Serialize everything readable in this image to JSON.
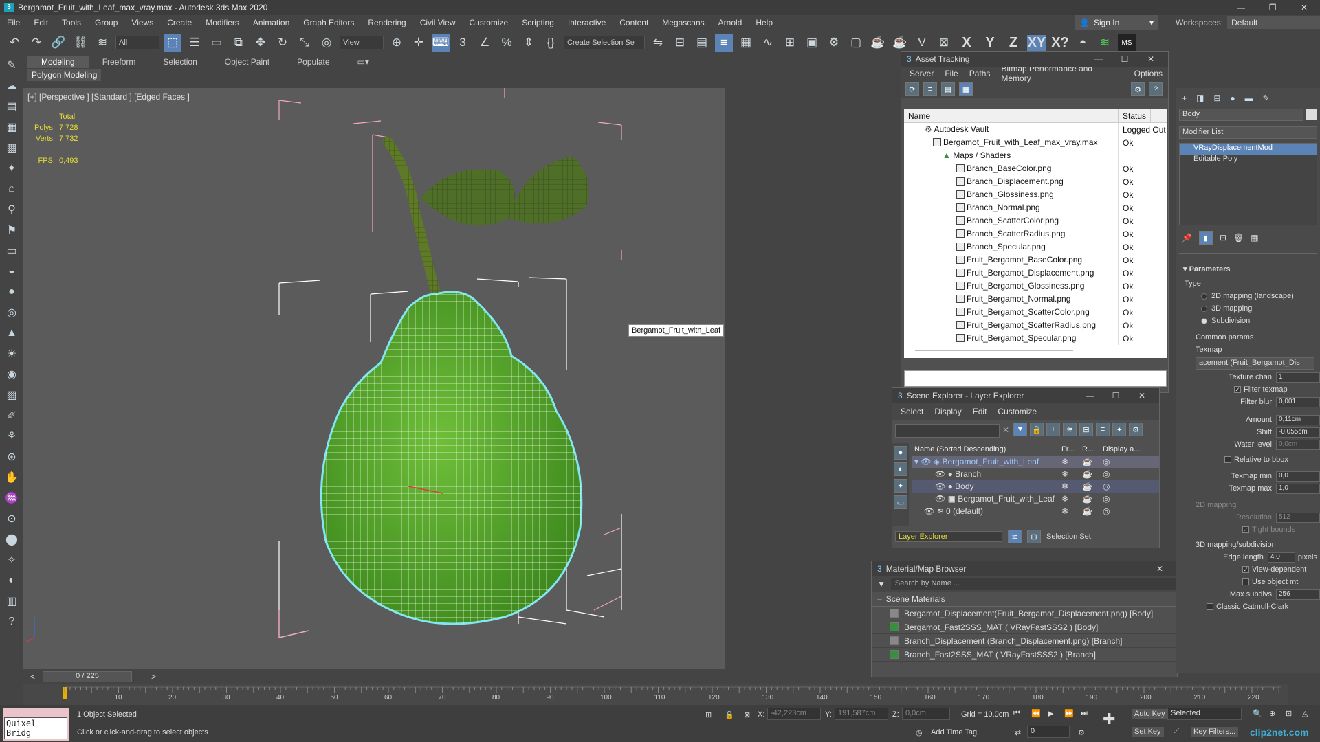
{
  "window": {
    "title": "Bergamot_Fruit_with_Leaf_max_vray.max - Autodesk 3ds Max 2020",
    "app_icon": "3"
  },
  "menu": [
    "File",
    "Edit",
    "Tools",
    "Group",
    "Views",
    "Create",
    "Modifiers",
    "Animation",
    "Graph Editors",
    "Rendering",
    "Civil View",
    "Customize",
    "Scripting",
    "Interactive",
    "Content",
    "Megascans",
    "Arnold",
    "Help"
  ],
  "signin": {
    "label": "Sign In"
  },
  "workspaces": {
    "label": "Workspaces:",
    "value": "Default"
  },
  "toolbar": {
    "filter": "All",
    "refcoord": "View",
    "selset": "Create Selection Se",
    "axes": [
      "X",
      "Y",
      "Z",
      "XY",
      "X?"
    ]
  },
  "ribbon": {
    "tabs": [
      "Modeling",
      "Freeform",
      "Selection",
      "Object Paint",
      "Populate"
    ],
    "sub": "Polygon Modeling"
  },
  "viewport": {
    "label": "[+] [Perspective ] [Standard ] [Edged Faces ]",
    "stats": {
      "total": "Total",
      "polys_label": "Polys:",
      "polys": "7 728",
      "verts_label": "Verts:",
      "verts": "7 732",
      "fps_label": "FPS:",
      "fps": "0,493"
    },
    "tooltip": "Bergamot_Fruit_with_Leaf"
  },
  "asset_tracking": {
    "title": "Asset Tracking",
    "menu": [
      "Server",
      "File",
      "Paths",
      "Bitmap Performance and Memory",
      "Options"
    ],
    "columns": [
      "Name",
      "Status"
    ],
    "rows": [
      {
        "name": "Autodesk Vault",
        "status": "Logged Out"
      },
      {
        "name": "Bergamot_Fruit_with_Leaf_max_vray.max",
        "status": "Ok"
      },
      {
        "name": "Maps / Shaders",
        "status": ""
      },
      {
        "name": "Branch_BaseColor.png",
        "status": "Ok"
      },
      {
        "name": "Branch_Displacement.png",
        "status": "Ok"
      },
      {
        "name": "Branch_Glossiness.png",
        "status": "Ok"
      },
      {
        "name": "Branch_Normal.png",
        "status": "Ok"
      },
      {
        "name": "Branch_ScatterColor.png",
        "status": "Ok"
      },
      {
        "name": "Branch_ScatterRadius.png",
        "status": "Ok"
      },
      {
        "name": "Branch_Specular.png",
        "status": "Ok"
      },
      {
        "name": "Fruit_Bergamot_BaseColor.png",
        "status": "Ok"
      },
      {
        "name": "Fruit_Bergamot_Displacement.png",
        "status": "Ok"
      },
      {
        "name": "Fruit_Bergamot_Glossiness.png",
        "status": "Ok"
      },
      {
        "name": "Fruit_Bergamot_Normal.png",
        "status": "Ok"
      },
      {
        "name": "Fruit_Bergamot_ScatterColor.png",
        "status": "Ok"
      },
      {
        "name": "Fruit_Bergamot_ScatterRadius.png",
        "status": "Ok"
      },
      {
        "name": "Fruit_Bergamot_Specular.png",
        "status": "Ok"
      }
    ]
  },
  "scene_explorer": {
    "title": "Scene Explorer - Layer Explorer",
    "menu": [
      "Select",
      "Display",
      "Edit",
      "Customize"
    ],
    "columns": [
      "Name (Sorted Descending)",
      "Fr...",
      "R...",
      "Display a..."
    ],
    "rows": [
      {
        "name": "Bergamot_Fruit_with_Leaf"
      },
      {
        "name": "Branch"
      },
      {
        "name": "Body"
      },
      {
        "name": "Bergamot_Fruit_with_Leaf"
      },
      {
        "name": "0 (default)"
      }
    ],
    "footer_layer": "Layer Explorer",
    "footer_selset": "Selection Set:"
  },
  "material_browser": {
    "title": "Material/Map Browser",
    "search_placeholder": "Search by Name ...",
    "section": "Scene Materials",
    "items": [
      "Bergamot_Displacement(Fruit_Bergamot_Displacement.png) [Body]",
      "Bergamot_Fast2SSS_MAT ( VRayFastSSS2 ) [Body]",
      "Branch_Displacement (Branch_Displacement.png) [Branch]",
      "Branch_Fast2SSS_MAT ( VRayFastSSS2 ) [Branch]"
    ]
  },
  "command_panel": {
    "object_name": "Body",
    "modifier_list": "Modifier List",
    "modifiers": [
      "VRayDisplacementMod",
      "Editable Poly"
    ],
    "parameters": {
      "title": "Parameters",
      "type_label": "Type",
      "types": [
        "2D mapping (landscape)",
        "3D mapping",
        "Subdivision"
      ],
      "common": "Common params",
      "texmap_label": "Texmap",
      "texmap_value": "acement (Fruit_Bergamot_Dis",
      "texture_chan_label": "Texture chan",
      "texture_chan": "1",
      "filter_texmap": "Filter texmap",
      "filter_blur_label": "Filter blur",
      "filter_blur": "0,001",
      "amount_label": "Amount",
      "amount": "0,11cm",
      "shift_label": "Shift",
      "shift": "-0,055cm",
      "water_label": "Water level",
      "water": "0,0cm",
      "relative": "Relative to bbox",
      "texmap_min_label": "Texmap min",
      "texmap_min": "0,0",
      "texmap_max_label": "Texmap max",
      "texmap_max": "1,0",
      "mapping2d": "2D mapping",
      "resolution_label": "Resolution",
      "resolution": "512",
      "tight": "Tight bounds",
      "mapping3d": "3D mapping/subdivision",
      "edge_label": "Edge length",
      "edge": "4,0",
      "pixels": "pixels",
      "view_dep": "View-dependent",
      "use_obj": "Use object mtl",
      "max_subdivs_label": "Max subdivs",
      "max_subdivs": "256",
      "classic": "Classic Catmull-Clark"
    }
  },
  "timeline": {
    "frame": "0 / 225",
    "ticks": [
      "10",
      "20",
      "30",
      "40",
      "50",
      "60",
      "70",
      "80",
      "90",
      "100",
      "110",
      "120",
      "130",
      "140",
      "150",
      "160",
      "170",
      "180",
      "190",
      "200",
      "210",
      "220"
    ]
  },
  "status": {
    "selected": "1 Object Selected",
    "hint": "Click or click-and-drag to select objects",
    "x_label": "X:",
    "x": "-42,223cm",
    "y_label": "Y:",
    "y": "191,587cm",
    "z_label": "Z:",
    "z": "0,0cm",
    "grid": "Grid = 10,0cm",
    "add_time_tag": "Add Time Tag",
    "autokey": "Auto Key",
    "setkey": "Set Key",
    "selected_dd": "Selected",
    "key_filters": "Key Filters...",
    "frame_field": "0",
    "quixel": "Quixel Bridg",
    "watermark": "clip2net.com"
  }
}
